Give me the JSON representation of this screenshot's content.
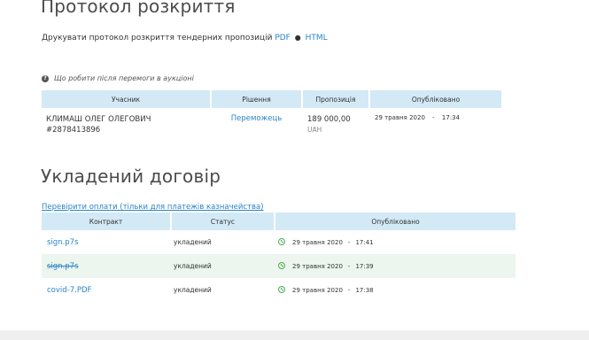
{
  "protocol": {
    "title": "Протокол розкриття",
    "print_text": "Друкувати протокол розкриття тендерних пропозицій",
    "pdf_label": "PDF",
    "bullet": "●",
    "html_label": "HTML",
    "help_text": "Що робити після перемоги в аукціоні",
    "table": {
      "headers": [
        "Учасник",
        "Рішення",
        "Пропозиція",
        "Опубліковано"
      ],
      "rows": [
        {
          "participant_name": "КЛИМАШ ОЛЕГ ОЛЕГОВИЧ",
          "participant_id": "#2878413896",
          "decision": "Переможець",
          "amount": "189 000,00",
          "currency": "UAH",
          "date": "29 травня 2020",
          "dash": "-",
          "time": "17:34"
        }
      ]
    }
  },
  "contract": {
    "title": "Укладений договір",
    "verify_link": "Перевірити оплати (тільки для платежів казначейства)",
    "table": {
      "headers": [
        "Контракт",
        "Статус",
        "Опубліковано"
      ],
      "rows": [
        {
          "file": "sign.p7s",
          "struck": false,
          "status": "укладений",
          "date": "29 травня 2020",
          "dash": "-",
          "time": "17:41"
        },
        {
          "file": "sign.p7s",
          "struck": true,
          "status": "укладений",
          "date": "29 травня 2020",
          "dash": "-",
          "time": "17:39"
        },
        {
          "file": "covid-7.PDF",
          "struck": false,
          "status": "укладений",
          "date": "29 травня 2020",
          "dash": "-",
          "time": "17:38"
        }
      ]
    }
  },
  "colors": {
    "link": "#2a84c6",
    "table_header_bg": "#d3e9f6",
    "alt_row_bg": "#ecf5ee",
    "clock_green": "#4caf50"
  }
}
